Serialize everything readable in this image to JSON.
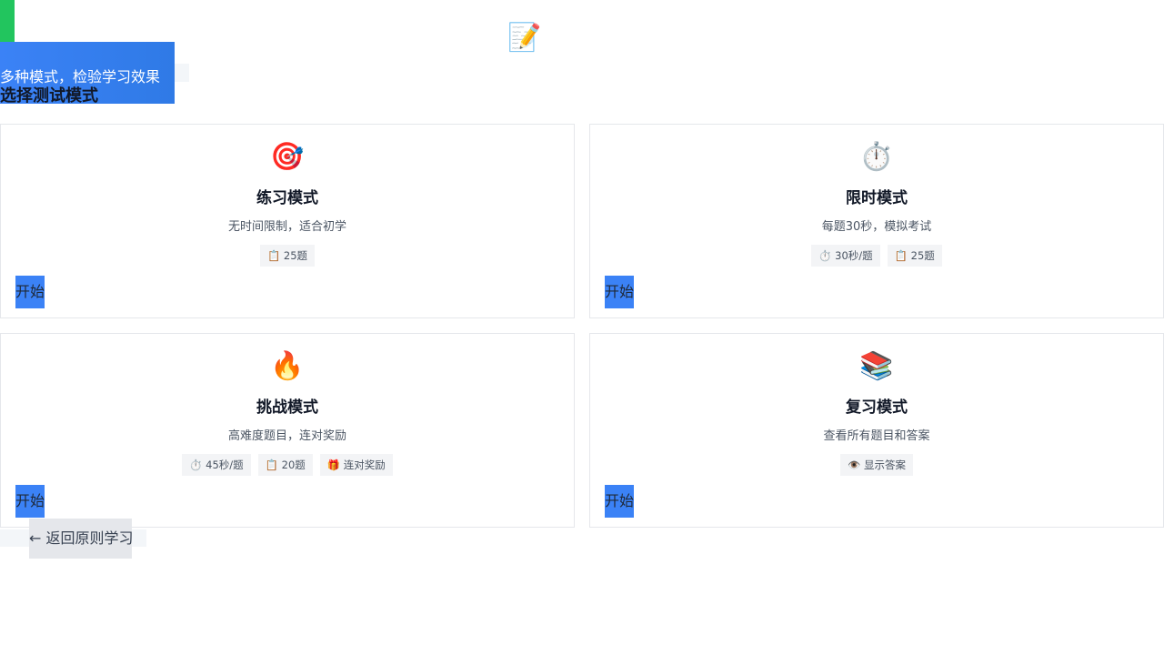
{
  "header": {
    "icon": "📝",
    "icon_name": "memo-icon",
    "subtitle": "多种模式，检验学习效果",
    "title": "选择测试模式"
  },
  "colors": {
    "accent": "#3b82f6",
    "green": "#22c55e"
  },
  "modes": [
    {
      "icon": "🎯",
      "icon_name": "target-icon",
      "title": "练习模式",
      "desc": "无时间限制，适合初学",
      "tags": [
        "📋 25题"
      ],
      "button": "开始"
    },
    {
      "icon": "⏱️",
      "icon_name": "stopwatch-icon",
      "title": "限时模式",
      "desc": "每题30秒，模拟考试",
      "tags": [
        "⏱️ 30秒/题",
        "📋 25题"
      ],
      "button": "开始"
    },
    {
      "icon": "🔥",
      "icon_name": "fire-icon",
      "title": "挑战模式",
      "desc": "高难度题目，连对奖励",
      "tags": [
        "⏱️ 45秒/题",
        "📋 20题",
        "🎁 连对奖励"
      ],
      "button": "开始"
    },
    {
      "icon": "📚",
      "icon_name": "books-icon",
      "title": "复习模式",
      "desc": "查看所有题目和答案",
      "tags": [
        "👁️ 显示答案"
      ],
      "button": "开始"
    }
  ],
  "back_button": "← 返回原则学习"
}
